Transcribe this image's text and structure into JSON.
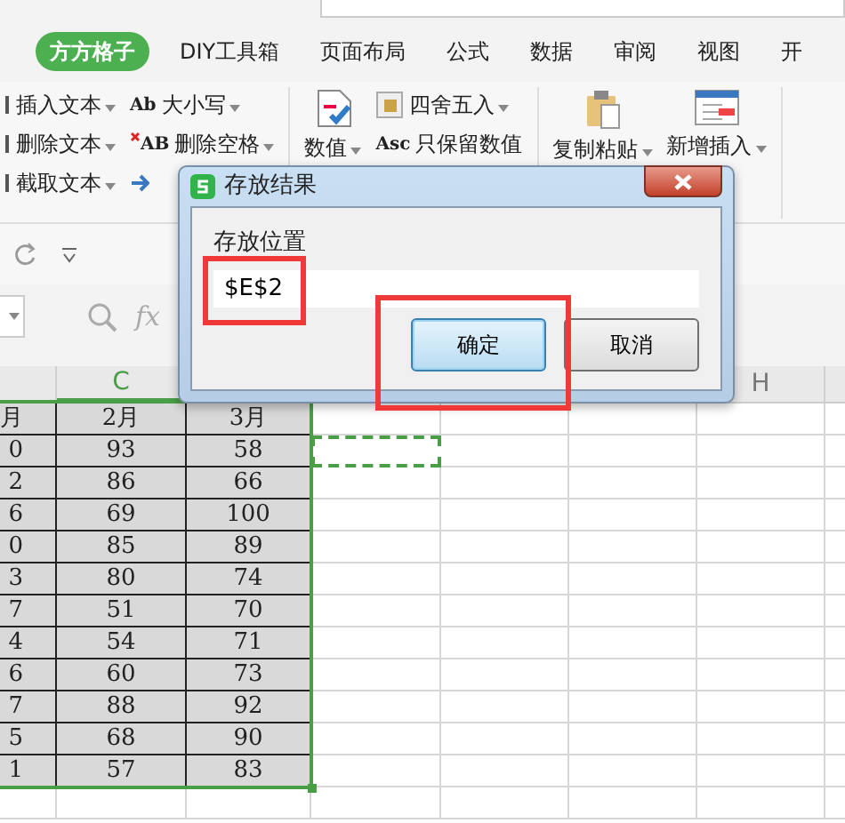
{
  "tabs": [
    {
      "label": "方方格子",
      "selected": true
    },
    {
      "label": "DIY工具箱",
      "selected": false
    },
    {
      "label": "页面布局",
      "selected": false
    },
    {
      "label": "公式",
      "selected": false
    },
    {
      "label": "数据",
      "selected": false
    },
    {
      "label": "审阅",
      "selected": false
    },
    {
      "label": "视图",
      "selected": false
    },
    {
      "label": "开",
      "selected": false
    }
  ],
  "ribbon": {
    "groups": [
      {
        "columns": [
          [
            {
              "kind": "text",
              "label": "插入文本",
              "dropdown": true
            },
            {
              "kind": "text",
              "label": "删除文本",
              "dropdown": true
            },
            {
              "kind": "text",
              "label": "截取文本",
              "dropdown": true
            }
          ],
          [
            {
              "kind": "glyph",
              "glyph": "Ab",
              "label": "大小写",
              "dropdown": true
            },
            {
              "kind": "trim",
              "glyph": "AB",
              "label": "删除空格",
              "dropdown": true
            },
            {
              "kind": "arrow"
            }
          ]
        ]
      },
      {
        "columns": [
          [
            {
              "kind": "large-number",
              "label": "数值",
              "dropdown": true
            }
          ],
          [
            {
              "kind": "round",
              "label": "四舍五入",
              "dropdown": true
            },
            {
              "kind": "glyph",
              "glyph": "Asc",
              "label": "只保留数值"
            }
          ]
        ]
      },
      {
        "columns": [
          [
            {
              "kind": "large-clipboard",
              "label": "复制粘贴",
              "dropdown": true
            }
          ],
          [
            {
              "kind": "large-form",
              "label": "新增插入",
              "dropdown": true
            }
          ]
        ]
      }
    ]
  },
  "formula_bar": {
    "fx": "fx"
  },
  "sheet": {
    "column_headers": [
      {
        "label": "C",
        "active": true
      },
      {
        "label": "H",
        "active": false
      }
    ],
    "range_selected": true,
    "rows": [
      {
        "cells": [
          "月",
          "2月",
          "3月"
        ],
        "marquee": false
      },
      {
        "cells": [
          "0",
          "93",
          "58"
        ],
        "marquee": true
      },
      {
        "cells": [
          "2",
          "86",
          "66"
        ],
        "marquee": false
      },
      {
        "cells": [
          "6",
          "69",
          "100"
        ],
        "marquee": false
      },
      {
        "cells": [
          "0",
          "85",
          "89"
        ],
        "marquee": false
      },
      {
        "cells": [
          "3",
          "80",
          "74"
        ],
        "marquee": false
      },
      {
        "cells": [
          "7",
          "51",
          "70"
        ],
        "marquee": false
      },
      {
        "cells": [
          "4",
          "54",
          "71"
        ],
        "marquee": false
      },
      {
        "cells": [
          "6",
          "60",
          "73"
        ],
        "marquee": false
      },
      {
        "cells": [
          "7",
          "88",
          "92"
        ],
        "marquee": false
      },
      {
        "cells": [
          "5",
          "68",
          "90"
        ],
        "marquee": false
      },
      {
        "cells": [
          "1",
          "57",
          "83"
        ],
        "marquee": false
      }
    ]
  },
  "dialog": {
    "title": "存放结果",
    "field_label": "存放位置",
    "value": "$E$2",
    "field_highlighted": true,
    "buttons": [
      {
        "label": "确定",
        "focused": true,
        "highlighted": true
      },
      {
        "label": "取消",
        "focused": false,
        "highlighted": false
      }
    ]
  }
}
